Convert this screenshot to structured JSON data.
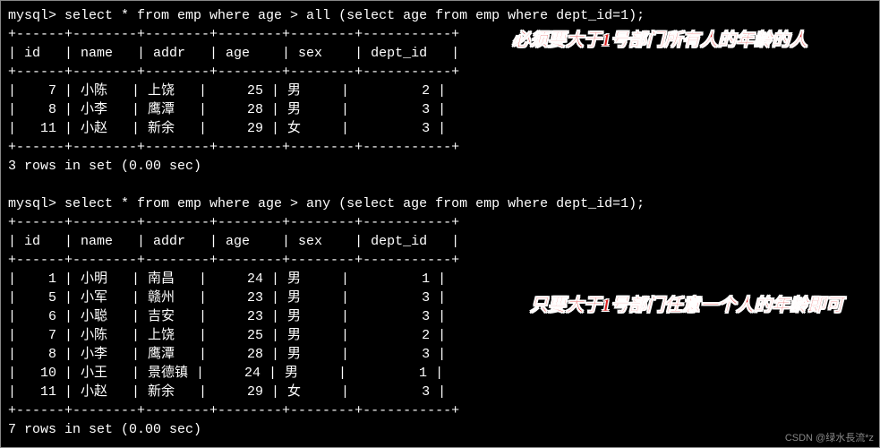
{
  "query1": {
    "prompt": "mysql> ",
    "sql": "select * from emp where age > all (select age from emp where dept_id=1);",
    "headers": [
      "id",
      "name",
      "addr",
      "age",
      "sex",
      "dept_id"
    ],
    "rows": [
      {
        "id": "7",
        "name": "小陈",
        "addr": "上饶",
        "age": "25",
        "sex": "男",
        "dept_id": "2"
      },
      {
        "id": "8",
        "name": "小李",
        "addr": "鹰潭",
        "age": "28",
        "sex": "男",
        "dept_id": "3"
      },
      {
        "id": "11",
        "name": "小赵",
        "addr": "新余",
        "age": "29",
        "sex": "女",
        "dept_id": "3"
      }
    ],
    "footer": "3 rows in set (0.00 sec)",
    "annotation": "必须要大于1号部门所有人的年龄的人"
  },
  "query2": {
    "prompt": "mysql> ",
    "sql": "select * from emp where age > any (select age from emp where dept_id=1);",
    "headers": [
      "id",
      "name",
      "addr",
      "age",
      "sex",
      "dept_id"
    ],
    "rows": [
      {
        "id": "1",
        "name": "小明",
        "addr": "南昌",
        "age": "24",
        "sex": "男",
        "dept_id": "1"
      },
      {
        "id": "5",
        "name": "小军",
        "addr": "赣州",
        "age": "23",
        "sex": "男",
        "dept_id": "3"
      },
      {
        "id": "6",
        "name": "小聪",
        "addr": "吉安",
        "age": "23",
        "sex": "男",
        "dept_id": "3"
      },
      {
        "id": "7",
        "name": "小陈",
        "addr": "上饶",
        "age": "25",
        "sex": "男",
        "dept_id": "2"
      },
      {
        "id": "8",
        "name": "小李",
        "addr": "鹰潭",
        "age": "28",
        "sex": "男",
        "dept_id": "3"
      },
      {
        "id": "10",
        "name": "小王",
        "addr": "景德镇",
        "age": "24",
        "sex": "男",
        "dept_id": "1"
      },
      {
        "id": "11",
        "name": "小赵",
        "addr": "新余",
        "age": "29",
        "sex": "女",
        "dept_id": "3"
      }
    ],
    "footer": "7 rows in set (0.00 sec)",
    "annotation": "只要大于1号部门任意一个人的年龄即可"
  },
  "watermark": "CSDN @绿水長流*z"
}
